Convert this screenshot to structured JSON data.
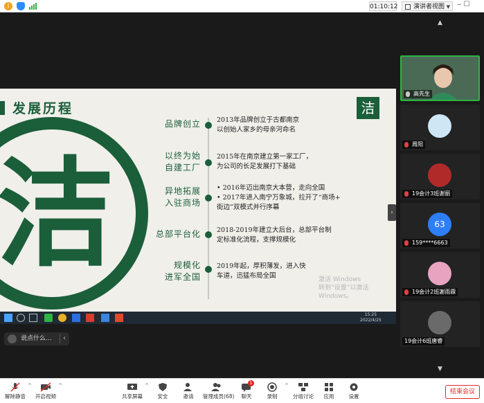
{
  "topbar": {
    "timer": "01:10:12",
    "view_label": "演讲者视图"
  },
  "slide": {
    "title": "发展历程",
    "logo_text": "洁",
    "emblem_text": "洁",
    "timeline": [
      {
        "label": [
          "品牌创立"
        ],
        "lines": [
          "2013年品牌创立于古都南京",
          "以创始人家乡的母亲河命名"
        ]
      },
      {
        "label": [
          "以终为始",
          "自建工厂"
        ],
        "lines": [
          "2015年在南京建立第一家工厂，",
          "为公司的长足发展打下基础"
        ]
      },
      {
        "label": [
          "异地拓展",
          "入驻商场"
        ],
        "lines": [
          "•  2016年迈出南京大本营，走向全国",
          "•  2017年进入南宁万象城，拉开了“商场+",
          "    街边”双模式并行序幕"
        ]
      },
      {
        "label": [
          "总部平台化"
        ],
        "lines": [
          "2018-2019年建立大后台，总部平台制",
          "定标准化流程，支撑规模化"
        ]
      },
      {
        "label": [
          "规模化",
          "进军全国"
        ],
        "lines": [
          "2019年起，厚积薄发，进入快",
          "车道，迅猛布局全国"
        ]
      }
    ],
    "watermark": [
      "激活 Windows",
      "转到“设置”以激活 Windows。"
    ]
  },
  "inner_taskbar": {
    "time": "15:25",
    "date": "2022/4/25"
  },
  "chat": {
    "placeholder": "说点什么..."
  },
  "participants": [
    {
      "name": "高先生",
      "mic": "on"
    },
    {
      "name": "周阳",
      "mic": "muted"
    },
    {
      "name": "19会计3班谢丽",
      "mic": "muted"
    },
    {
      "name": "159****6663",
      "mic": "muted",
      "avatar_text": "63"
    },
    {
      "name": "19会计2班謝雨霖",
      "mic": "muted"
    },
    {
      "name": "19会计6班唐睿",
      "mic": "none"
    }
  ],
  "toolbar": {
    "mute": "解除静音",
    "video": "开启视频",
    "share": "共享屏幕",
    "security": "安全",
    "invite": "邀请",
    "participants": "管理成员(68)",
    "chat": "聊天",
    "chat_badge": "1",
    "record": "录制",
    "breakout": "分组讨论",
    "apps": "应用",
    "settings": "设置",
    "end": "结束会议"
  },
  "colors": {
    "brand_green": "#1b5e3a",
    "end_red": "#e02828",
    "active_border": "#2fb344"
  }
}
